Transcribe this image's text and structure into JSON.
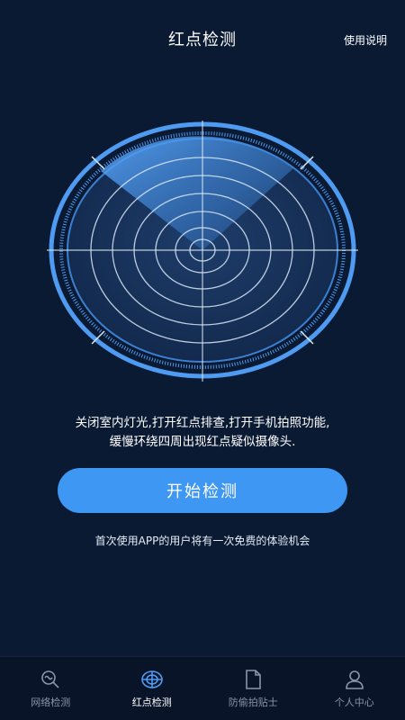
{
  "header": {
    "title": "红点检测",
    "help_label": "使用说明"
  },
  "instruction": {
    "line1": "关闭室内灯光,打开红点排查,打开手机拍照功能,",
    "line2": "缓慢环绕四周出现红点疑似摄像头."
  },
  "start_button_label": "开始检测",
  "note": "首次使用APP的用户将有一次免费的体验机会",
  "tabs": [
    {
      "label": "网络检测",
      "icon": "network-search-icon",
      "active": false
    },
    {
      "label": "红点检测",
      "icon": "radar-icon",
      "active": true
    },
    {
      "label": "防偷拍贴士",
      "icon": "document-icon",
      "active": false
    },
    {
      "label": "个人中心",
      "icon": "person-icon",
      "active": false
    }
  ],
  "colors": {
    "background": "#0b1a33",
    "accent": "#3f97f4",
    "tab_inactive": "#8b95a8"
  }
}
